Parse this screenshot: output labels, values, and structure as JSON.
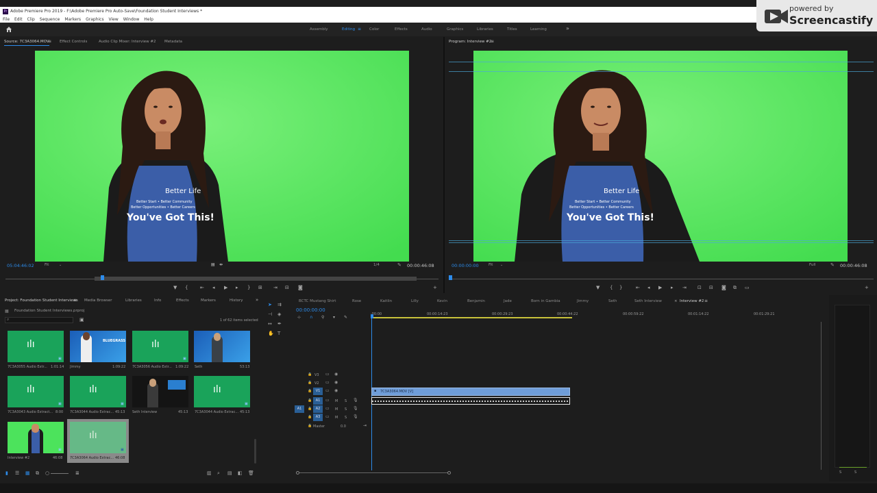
{
  "window": {
    "title": "Adobe Premiere Pro 2019 - F:\\Adobe Premiere Pro Auto-Save\\Foundation Student Interviews *",
    "app_icon": "Pr"
  },
  "menu": [
    "File",
    "Edit",
    "Clip",
    "Sequence",
    "Markers",
    "Graphics",
    "View",
    "Window",
    "Help"
  ],
  "overlay": {
    "line1": "powered by",
    "line2": "Screencastify"
  },
  "workspaces": {
    "items": [
      "Assembly",
      "Editing",
      "Color",
      "Effects",
      "Audio",
      "Graphics",
      "Libraries",
      "Titles",
      "Learning"
    ],
    "active": "Editing",
    "overflow": "»"
  },
  "source_panel": {
    "tabs": [
      "Source: 7C3A3064.MOV",
      "Effect Controls",
      "Audio Clip Mixer: Interview #2",
      "Metadata"
    ],
    "timecode_in": "05:04:46:02",
    "zoom": "Fit",
    "resolution": "1/4",
    "duration": "00:00:46:08",
    "playhead_fraction": 0.22
  },
  "program_panel": {
    "title": "Program: Interview #2",
    "timecode_in": "00:00:00:00",
    "zoom": "Fit",
    "resolution": "Full",
    "duration": "00:00:46:08",
    "playhead_fraction": 0.0
  },
  "shirt_text": {
    "brand": "Better Life",
    "line2": "Better Start • Better Community",
    "line3": "Better Opportunities • Better Careers",
    "slogan": "You've Got This!"
  },
  "project_panel": {
    "tabs": [
      "Project: Foundation Student Interviews",
      "Media Browser",
      "Libraries",
      "Info",
      "Effects",
      "Markers",
      "History"
    ],
    "overflow": "»",
    "file": "Foundation Student Interviews.prproj",
    "search_placeholder": "",
    "selection_status": "1 of 62 items selected",
    "items": [
      {
        "name": "7C3A3055 Audio Extr...",
        "duration": "1:01:14",
        "kind": "audio"
      },
      {
        "name": "Jimmy",
        "duration": "1:09:22",
        "kind": "video-blue"
      },
      {
        "name": "7C3A3056 Audio Extr...",
        "duration": "1:09:22",
        "kind": "audio"
      },
      {
        "name": "Seth",
        "duration": "53:13",
        "kind": "video-blue"
      },
      {
        "name": "7C3A3043 Audio Extract...",
        "duration": "8:00",
        "kind": "audio"
      },
      {
        "name": "7C3A3044 Audio Extrac...",
        "duration": "45:13",
        "kind": "audio"
      },
      {
        "name": "Seth Interview",
        "duration": "45:13",
        "kind": "video-dark"
      },
      {
        "name": "7C3A3044 Audio Extrac...",
        "duration": "45:13",
        "kind": "audio"
      },
      {
        "name": "Interview #2",
        "duration": "46:08",
        "kind": "video-green"
      },
      {
        "name": "7C3A3064 Audio Extrac...",
        "duration": "46:08",
        "kind": "audio-selected"
      }
    ],
    "thumb_brand": "BLUEGRASS"
  },
  "timeline": {
    "tabs": [
      "BCTC Mustang Shirt",
      "Rose",
      "Kaitlin",
      "Lilly",
      "Kevin",
      "Benjamin",
      "Jade",
      "Born in Gambia",
      "Jimmy",
      "Seth",
      "Seth Interview",
      "Interview #2"
    ],
    "active_tab": "Interview #2",
    "close_glyph": "×",
    "timecode": "00:00:00:00",
    "ruler": [
      ":00:00",
      "00:00:14:23",
      "00:00:29:23",
      "00:00:44:22",
      "00:00:59:22",
      "00:01:14:22",
      "00:01:29:21"
    ],
    "tracks": [
      {
        "name": "V3",
        "type": "video"
      },
      {
        "name": "V2",
        "type": "video"
      },
      {
        "name": "V1",
        "type": "video"
      },
      {
        "name": "A1",
        "type": "audio"
      },
      {
        "name": "A2",
        "type": "audio"
      },
      {
        "name": "A3",
        "type": "audio"
      }
    ],
    "source_patch_audio": "A1",
    "master_label": "Master",
    "master_value": "0.0",
    "video_clip": "7C3A3064.MOV [V]",
    "track_buttons": {
      "mute": "M",
      "solo": "S"
    },
    "clip_end_fraction": 0.44
  },
  "audio_meter": {
    "labels": [
      "S",
      "S"
    ]
  },
  "colors": {
    "accent": "#2d8ceb",
    "green_screen": "#4ce35c",
    "video_clip": "#6f9dd8",
    "audio_thumb": "#1aa35a",
    "panel_bg": "#1d1d1d",
    "overlay_bg": "#e8e8e8"
  }
}
